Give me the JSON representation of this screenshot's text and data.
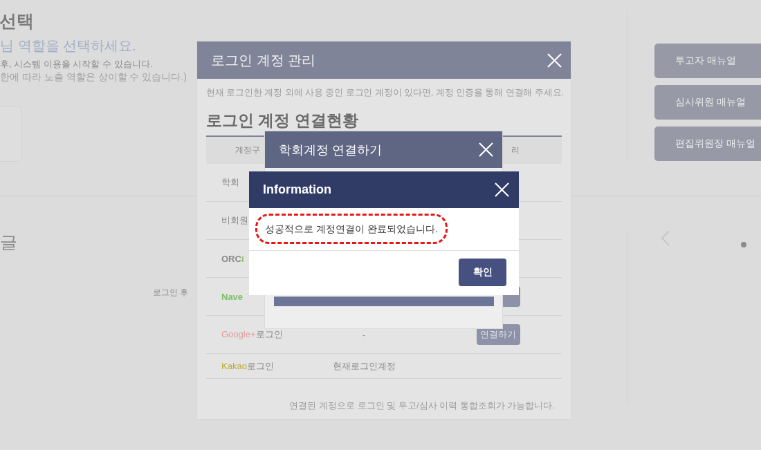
{
  "page": {
    "title": "선택",
    "subtitle": "님 역할을 선택하세요.",
    "notes": [
      "후, 시스템 이용을 시작할 수 있습니다.",
      "한에 따라 노출 역할은 상이할 수 있습니다.)"
    ],
    "section_title": "글",
    "hint": "로그인 후",
    "manual_buttons": [
      "투고자 매뉴얼",
      "심사위원 매뉴얼",
      "편집위원장 매뉴얼"
    ]
  },
  "account_dialog": {
    "title": "로그인 계정 관리",
    "description": "현재 로그인한 계정 외에 사용 중인 로그인 계정이 있다면, 계정 인증을 통해 연결해 주세요.",
    "heading": "로그인 계정 연결현황",
    "columns": [
      "계정구",
      "리"
    ],
    "rows": [
      {
        "segments": [
          {
            "text": "학회"
          }
        ]
      },
      {
        "segments": [
          {
            "text": "비회원"
          }
        ]
      },
      {
        "segments": [
          {
            "text": "ORC",
            "bold": true
          },
          {
            "text": "i",
            "bold": true,
            "color": "#8cc46a"
          }
        ]
      },
      {
        "segments": [
          {
            "text": "Nave",
            "bold": true,
            "color": "#7cbf6a"
          }
        ],
        "action": {
          "kind": "covered"
        }
      },
      {
        "segments": [
          {
            "text": "Google+",
            "color": "#e09a9a"
          },
          {
            "text": "로그인"
          }
        ],
        "status": "-",
        "action": {
          "kind": "button",
          "label": "연결하기"
        }
      },
      {
        "segments": [
          {
            "text": "Kakao",
            "color": "#bfa92e"
          },
          {
            "text": "로그인"
          }
        ],
        "status": "현재로그인계정"
      }
    ],
    "footer": "연결된 계정으로 로그인 및 투고/심사 이력 통합조회가 가능합니다."
  },
  "connect_dialog": {
    "title": "학회계정 연결하기"
  },
  "info_dialog": {
    "title": "Information",
    "message": "성공적으로 계정연결이 완료되었습니다.",
    "highlighted": true,
    "confirm": "확인"
  }
}
